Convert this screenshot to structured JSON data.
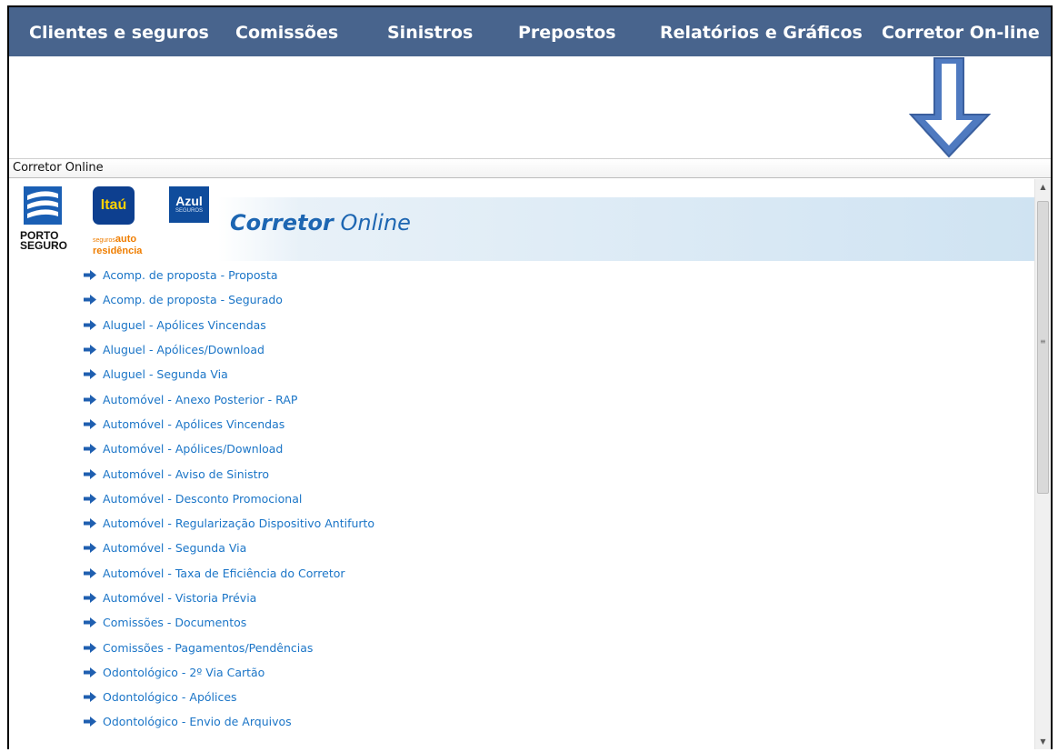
{
  "topnav": {
    "items": [
      {
        "label": "Clientes e seguros"
      },
      {
        "label": "Comissões"
      },
      {
        "label": "Sinistros"
      },
      {
        "label": "Prepostos"
      },
      {
        "label": "Relatórios e Gráficos"
      },
      {
        "label": "Corretor On-line"
      }
    ]
  },
  "section": {
    "title": "Corretor Online"
  },
  "banner": {
    "title_bold": "Corretor",
    "title_light": "Online",
    "logos": {
      "porto": {
        "line1": "PORTO",
        "line2": "SEGURO"
      },
      "itau": {
        "name": "Itaú",
        "sub1": "seguros",
        "sub2": "auto",
        "sub3": "residência"
      },
      "azul": {
        "name": "Azul",
        "sub": "SEGUROS"
      }
    }
  },
  "links": [
    "Acomp. de proposta - Proposta",
    "Acomp. de proposta - Segurado",
    "Aluguel - Apólices Vincendas",
    "Aluguel - Apólices/Download",
    "Aluguel - Segunda Via",
    "Automóvel - Anexo Posterior - RAP",
    "Automóvel - Apólices Vincendas",
    "Automóvel - Apólices/Download",
    "Automóvel - Aviso de Sinistro",
    "Automóvel - Desconto Promocional",
    "Automóvel - Regularização Dispositivo Antifurto",
    "Automóvel - Segunda Via",
    "Automóvel - Taxa de Eficiência do Corretor",
    "Automóvel - Vistoria Prévia",
    "Comissões - Documentos",
    "Comissões - Pagamentos/Pendências",
    "Odontológico - 2º Via Cartão",
    "Odontológico - Apólices",
    "Odontológico - Envio de Arquivos"
  ],
  "icons": {
    "link_arrow": "arrow-right-icon",
    "annotation": "down-arrow-icon"
  },
  "colors": {
    "nav_bg": "#48648d",
    "link": "#1b75c7",
    "arrow_fill": "#4f7ac0"
  }
}
